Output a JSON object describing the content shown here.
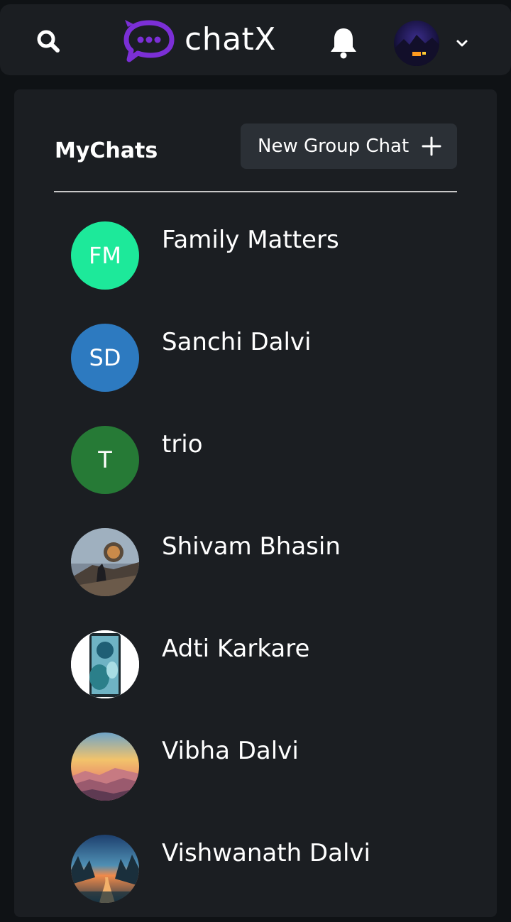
{
  "header": {
    "brand": "chatX",
    "icons": {
      "search": "search-icon",
      "logo": "chat-bubble-logo",
      "bell": "bell-icon",
      "chevron": "chevron-down-icon"
    },
    "brand_color": "#7b2fd6"
  },
  "panel": {
    "title": "MyChats",
    "new_group_label": "New Group Chat"
  },
  "chats": [
    {
      "name": "Family Matters",
      "initials": "FM",
      "avatar_color": "#1de99a",
      "avatar_type": "initials"
    },
    {
      "name": "Sanchi Dalvi",
      "initials": "SD",
      "avatar_color": "#2d7ac0",
      "avatar_type": "initials"
    },
    {
      "name": "trio",
      "initials": "T",
      "avatar_color": "#267a36",
      "avatar_type": "initials"
    },
    {
      "name": "Shivam Bhasin",
      "initials": "",
      "avatar_type": "photo"
    },
    {
      "name": "Adti Karkare",
      "initials": "",
      "avatar_type": "photo"
    },
    {
      "name": "Vibha Dalvi",
      "initials": "",
      "avatar_type": "photo"
    },
    {
      "name": "Vishwanath Dalvi",
      "initials": "",
      "avatar_type": "photo"
    }
  ]
}
